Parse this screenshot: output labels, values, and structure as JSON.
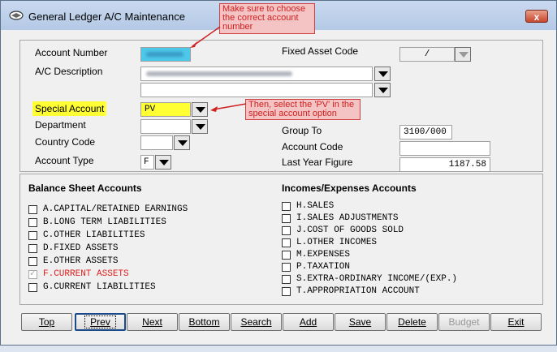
{
  "window": {
    "title": "General Ledger A/C Maintenance",
    "close_label": "x"
  },
  "form": {
    "account_number_label": "Account Number",
    "fixed_asset_code_label": "Fixed Asset Code",
    "fixed_asset_code_value": "/",
    "ac_description_label": "A/C Description",
    "special_account_label": "Special Account",
    "special_account_value": "PV",
    "department_label": "Department",
    "country_code_label": "Country Code",
    "account_type_label": "Account Type",
    "account_type_value": "F",
    "group_to_label": "Group To",
    "group_to_value": "3100/000",
    "account_code_label": "Account Code",
    "account_code_value": "",
    "last_year_figure_label": "Last Year Figure",
    "last_year_figure_value": "1187.58"
  },
  "balance_sheet": {
    "title": "Balance Sheet Accounts",
    "items": [
      {
        "label": "A.CAPITAL/RETAINED EARNINGS",
        "checked": false,
        "active": false
      },
      {
        "label": "B.LONG TERM LIABILITIES",
        "checked": false,
        "active": false
      },
      {
        "label": "C.OTHER LIABILITIES",
        "checked": false,
        "active": false
      },
      {
        "label": "D.FIXED ASSETS",
        "checked": false,
        "active": false
      },
      {
        "label": "E.OTHER ASSETS",
        "checked": false,
        "active": false
      },
      {
        "label": "F.CURRENT ASSETS",
        "checked": true,
        "active": true
      },
      {
        "label": "G.CURRENT LIABILITIES",
        "checked": false,
        "active": false
      }
    ]
  },
  "income_expenses": {
    "title": "Incomes/Expenses Accounts",
    "items": [
      {
        "label": "H.SALES"
      },
      {
        "label": "I.SALES ADJUSTMENTS"
      },
      {
        "label": "J.COST OF GOODS SOLD"
      },
      {
        "label": "L.OTHER INCOMES"
      },
      {
        "label": "M.EXPENSES"
      },
      {
        "label": "P.TAXATION"
      },
      {
        "label": "S.EXTRA-ORDINARY INCOME/(EXP.)"
      },
      {
        "label": "T.APPROPRIATION ACCOUNT"
      }
    ]
  },
  "buttons": {
    "top": "Top",
    "prev": "Prev",
    "next": "Next",
    "bottom": "Bottom",
    "search": "Search",
    "add": "Add",
    "save": "Save",
    "delete": "Delete",
    "budget": "Budget",
    "exit": "Exit"
  },
  "annotations": {
    "callout1": "Make sure to choose the correct account number",
    "callout2": "Then, select the 'PV' in the special account option"
  },
  "colors": {
    "highlight": "#ffff33",
    "active_text": "#e02020",
    "callout_border": "#d04040"
  }
}
